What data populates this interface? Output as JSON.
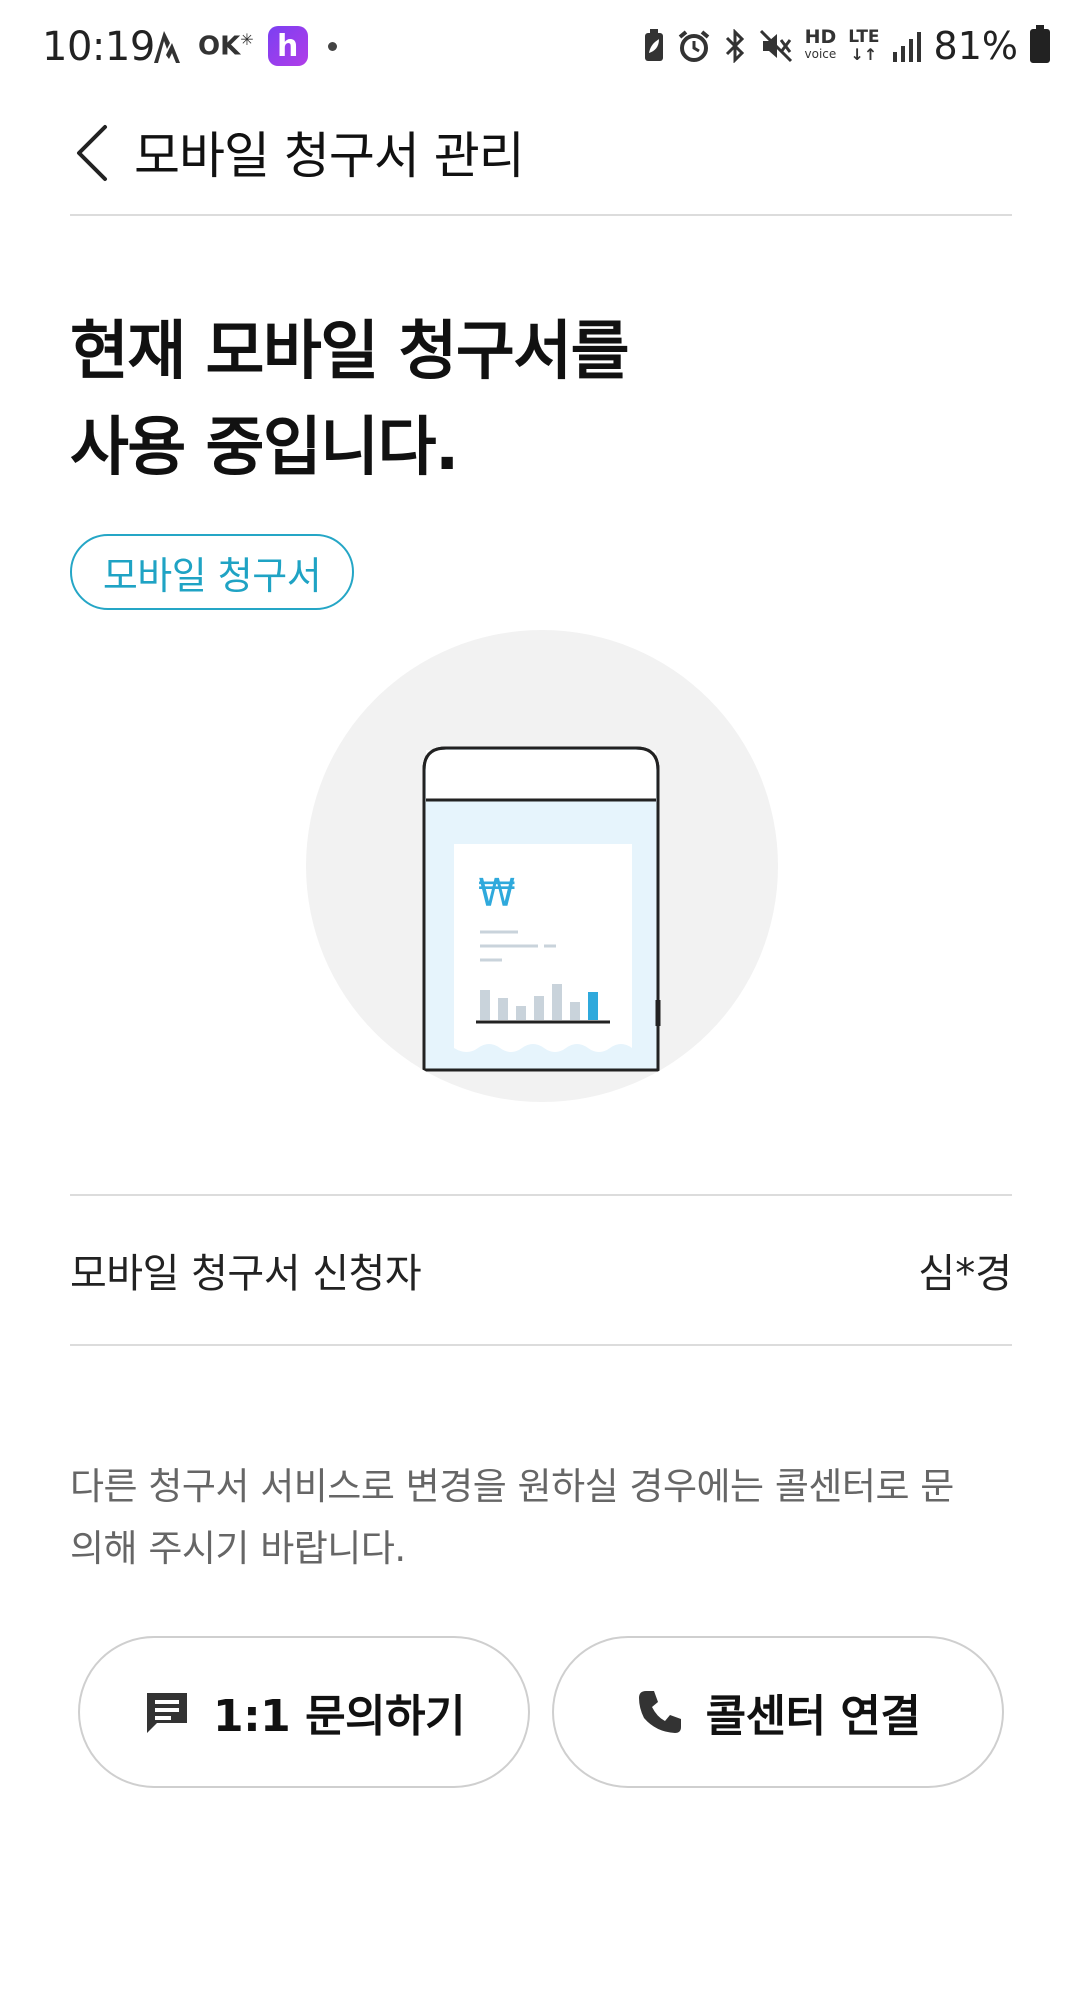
{
  "status_bar": {
    "time": "10:19",
    "left_icons": [
      "strava-icon",
      "okcashbag-icon",
      "happy-point-icon",
      "notification-dot-icon"
    ],
    "okcash_label": "OK",
    "happy_label": "h",
    "right_icons": [
      "battery-saver-icon",
      "alarm-icon",
      "bluetooth-icon",
      "mute-icon",
      "hd-voice-icon",
      "lte-icon",
      "signal-icon",
      "battery-icon"
    ],
    "hd_label": "HD",
    "voice_label": "voice",
    "lte_label": "LTE",
    "battery_percent": "81%"
  },
  "header": {
    "title": "모바일 청구서 관리"
  },
  "main": {
    "headline_line1": "현재 모바일 청구서를",
    "headline_line2": "사용 중입니다.",
    "chip_label": "모바일 청구서",
    "illustration_currency": "₩",
    "colors": {
      "accent": "#25a6c6",
      "chart_highlight": "#2fa9dc",
      "chart_bar": "#c9d3db",
      "phone_screen": "#e6f4fc",
      "circle_bg": "#f2f2f2"
    }
  },
  "info": {
    "label": "모바일 청구서 신청자",
    "value": "심*경"
  },
  "notice": {
    "line1": "다른 청구서 서비스로 변경을 원하실 경우에는 콜센터로 문",
    "line2": "의해 주시기 바랍니다."
  },
  "buttons": {
    "inquiry_label": "1:1 문의하기",
    "inquiry_icon": "chat-icon",
    "callcenter_label": "콜센터 연결",
    "callcenter_icon": "phone-icon"
  }
}
